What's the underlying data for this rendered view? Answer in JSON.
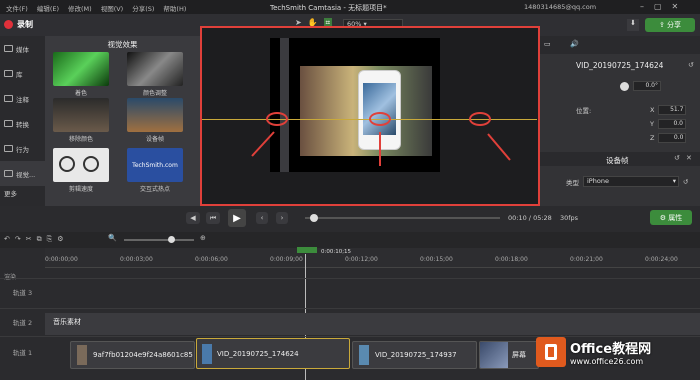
{
  "menu": [
    "文件(F)",
    "编辑(E)",
    "修改(M)",
    "视图(V)",
    "分享(S)",
    "帮助(H)"
  ],
  "app_title": "TechSmith Camtasia - 无标题项目*",
  "account": "1480314685@qq.com",
  "record": "录制",
  "share": "分享",
  "zoom": "60%",
  "sidebar": [
    "媒体",
    "库",
    "注释",
    "转换",
    "行为",
    "视觉..."
  ],
  "sidebar_more": "更多",
  "lib_title": "视觉效果",
  "effects": [
    "着色",
    "颜色调整",
    "移除颜色",
    "设备帧",
    "剪辑速度",
    "交互式热点"
  ],
  "techsmith_badge": "TechSmith.com",
  "props": {
    "clip_name": "VID_20190725_174624",
    "rotate": "0.0°",
    "pos_label": "位置:",
    "x": "51.7",
    "y": "0.0",
    "z": "0.0",
    "device_frame": "设备帧",
    "type_label": "类型",
    "type_value": "iPhone",
    "prop_btn": "属性"
  },
  "time": {
    "current": "00:10",
    "total": "05:28",
    "fps": "30fps",
    "playhead": "0:00:10;15"
  },
  "ruler": [
    "0:00:00;00",
    "0:00:03;00",
    "0:00:06;00",
    "0:00:09;00",
    "0:00:12;00",
    "0:00:15;00",
    "0:00:18;00",
    "0:00:21;00",
    "0:00:24;00"
  ],
  "tracks": {
    "t3": "轨道 3",
    "t2": "轨道 2",
    "t1": "轨道 1",
    "music": "音乐素材"
  },
  "clips": [
    "9af7fb01204e9f24a8601c85",
    "VID_20190725_174624",
    "VID_20190725_174937",
    "屏幕"
  ],
  "track_btn": "渲染",
  "watermark": {
    "title": "Office教程网",
    "url": "www.office26.com"
  }
}
